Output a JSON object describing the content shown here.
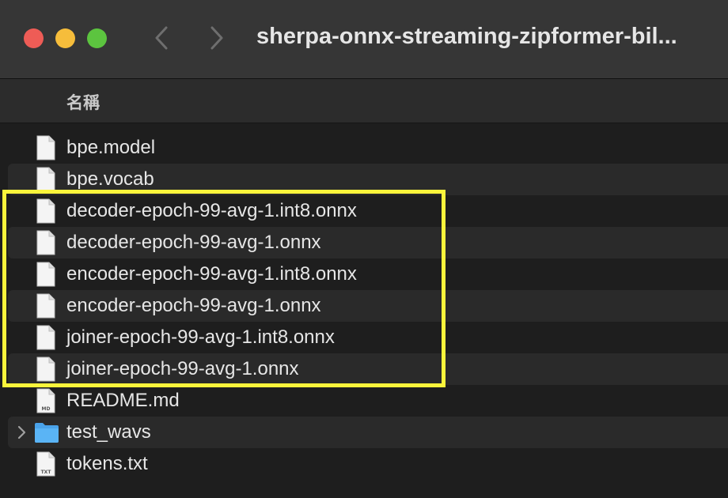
{
  "window": {
    "title": "sherpa-onnx-streaming-zipformer-bil..."
  },
  "colors": {
    "titlebar": "#363636",
    "header": "#2c2c2c",
    "background": "#1e1e1e",
    "alt_row": "#2a2a2a",
    "highlight": "#fbf43b",
    "folder": "#4aa3ea",
    "close": "#ee5c56",
    "minimize": "#f6bd3b",
    "zoom": "#5cc43f"
  },
  "column_header": {
    "name_label": "名稱"
  },
  "files": [
    {
      "name": "bpe.model",
      "kind": "file",
      "icon": "document-icon",
      "badge": ""
    },
    {
      "name": "bpe.vocab",
      "kind": "file",
      "icon": "document-icon",
      "badge": ""
    },
    {
      "name": "decoder-epoch-99-avg-1.int8.onnx",
      "kind": "file",
      "icon": "document-icon",
      "badge": ""
    },
    {
      "name": "decoder-epoch-99-avg-1.onnx",
      "kind": "file",
      "icon": "document-icon",
      "badge": ""
    },
    {
      "name": "encoder-epoch-99-avg-1.int8.onnx",
      "kind": "file",
      "icon": "document-icon",
      "badge": ""
    },
    {
      "name": "encoder-epoch-99-avg-1.onnx",
      "kind": "file",
      "icon": "document-icon",
      "badge": ""
    },
    {
      "name": "joiner-epoch-99-avg-1.int8.onnx",
      "kind": "file",
      "icon": "document-icon",
      "badge": ""
    },
    {
      "name": "joiner-epoch-99-avg-1.onnx",
      "kind": "file",
      "icon": "document-icon",
      "badge": ""
    },
    {
      "name": "README.md",
      "kind": "file",
      "icon": "markdown-file-icon",
      "badge": "MD"
    },
    {
      "name": "test_wavs",
      "kind": "folder",
      "icon": "folder-icon",
      "badge": ""
    },
    {
      "name": "tokens.txt",
      "kind": "file",
      "icon": "text-file-icon",
      "badge": "TXT"
    }
  ]
}
